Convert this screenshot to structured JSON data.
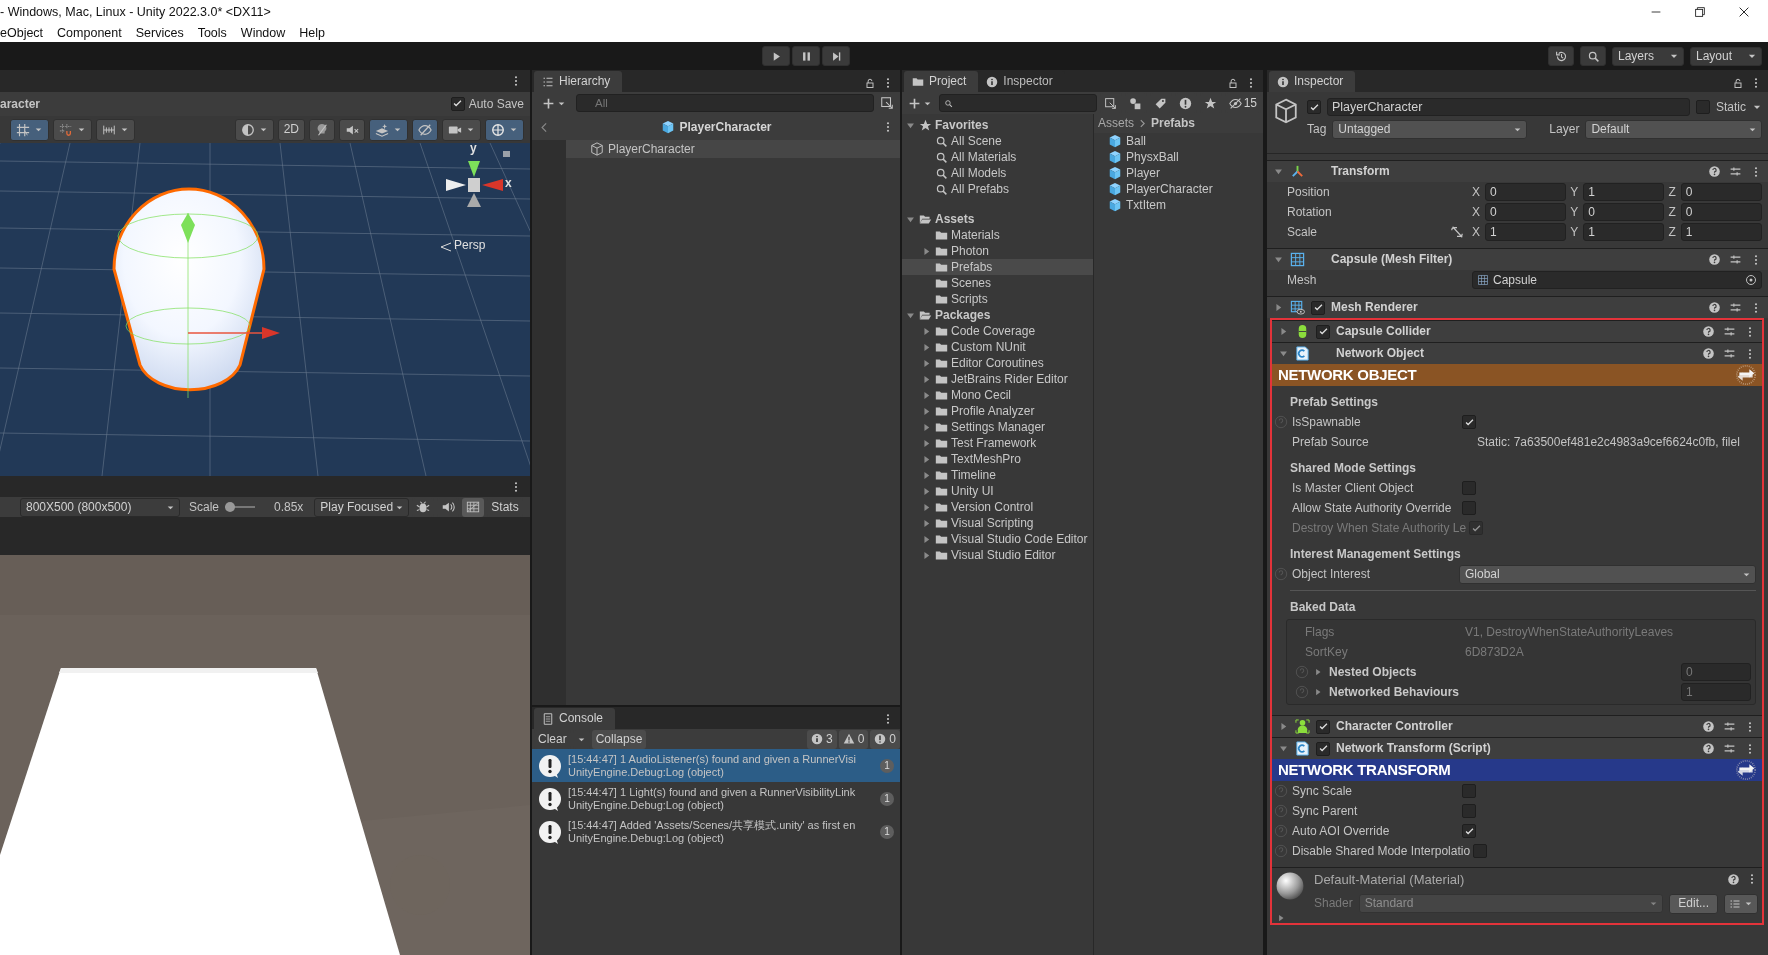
{
  "window": {
    "title": "- Windows, Mac, Linux - Unity 2022.3.0* <DX11>"
  },
  "menu": [
    "eObject",
    "Component",
    "Services",
    "Tools",
    "Window",
    "Help"
  ],
  "main_toolbar": {
    "layers": "Layers",
    "layout": "Layout"
  },
  "scene": {
    "title": "aracter",
    "auto_save": {
      "label": "Auto Save",
      "checked": true
    },
    "tools": [
      {
        "kind": "grid",
        "selected": true,
        "dropdown": true
      },
      {
        "kind": "snap",
        "selected": false,
        "dropdown": true
      },
      {
        "kind": "increment",
        "selected": false,
        "dropdown": true
      },
      {
        "kind": "shading",
        "selected": false,
        "dropdown": true
      },
      {
        "kind": "mode2d",
        "label": "2D",
        "selected": false,
        "dropdown": false
      },
      {
        "kind": "light",
        "selected": false,
        "dropdown": false
      },
      {
        "kind": "audio",
        "selected": false,
        "dropdown": false
      },
      {
        "kind": "effects",
        "selected": true,
        "dropdown": true
      },
      {
        "kind": "visibility",
        "selected": true,
        "dropdown": false
      },
      {
        "kind": "camera",
        "selected": false,
        "dropdown": true
      },
      {
        "kind": "gizmos",
        "selected": true,
        "dropdown": true
      }
    ],
    "gizmo_labels": [
      "y",
      "x"
    ],
    "view": "Persp"
  },
  "game": {
    "resolution": "800X500 (800x500)",
    "scale_label": "Scale",
    "scale": "0.85x",
    "play_mode": "Play Focused",
    "tools": [
      {
        "kind": "bug",
        "selected": false
      },
      {
        "kind": "audio",
        "selected": false
      },
      {
        "kind": "gizmos",
        "selected": true
      }
    ],
    "stats": "Stats"
  },
  "hierarchy": {
    "tab": "Hierarchy",
    "search_placeholder": "All",
    "header": "PlayerCharacter",
    "items": [
      {
        "label": "PlayerCharacter",
        "selected": true
      }
    ]
  },
  "console": {
    "tab": "Console",
    "clear": "Clear",
    "collapse": "Collapse",
    "counts": [
      {
        "kind": "info",
        "value": "3"
      },
      {
        "kind": "warning",
        "value": "0"
      },
      {
        "kind": "error",
        "value": "0"
      }
    ],
    "messages": [
      {
        "line1": "[15:44:47] 1 AudioListener(s) found and given a RunnerVisi",
        "line2": "UnityEngine.Debug:Log (object)",
        "count": "1",
        "selected": true
      },
      {
        "line1": "[15:44:47] 1 Light(s) found and given a RunnerVisibilityLink",
        "line2": "UnityEngine.Debug:Log (object)",
        "count": "1",
        "selected": false
      },
      {
        "line1": "[15:44:47] Added 'Assets/Scenes/共享模式.unity' as first en",
        "line2": "UnityEngine.Debug:Log (object)",
        "count": "1",
        "selected": false
      }
    ]
  },
  "project": {
    "tabs": [
      {
        "label": "Project",
        "selected": true
      },
      {
        "label": "Inspector",
        "selected": false
      }
    ],
    "hidden_count": "15",
    "tree": [
      {
        "label": "Favorites",
        "kind": "favorites",
        "selected": false,
        "children": [
          {
            "label": "All Scene",
            "kind": "search",
            "selected": false
          },
          {
            "label": "All Materials",
            "kind": "search",
            "selected": false
          },
          {
            "label": "All Models",
            "kind": "search",
            "selected": false
          },
          {
            "label": "All Prefabs",
            "kind": "search",
            "selected": false
          }
        ]
      },
      {
        "label": "Assets",
        "kind": "group",
        "selected": false,
        "children": [
          {
            "label": "Materials",
            "kind": "folder",
            "selected": false
          },
          {
            "label": "Photon",
            "kind": "collapsed_folder",
            "selected": false
          },
          {
            "label": "Prefabs",
            "kind": "folder",
            "selected": true
          },
          {
            "label": "Scenes",
            "kind": "folder",
            "selected": false
          },
          {
            "label": "Scripts",
            "kind": "folder",
            "selected": false
          }
        ]
      },
      {
        "label": "Packages",
        "kind": "group",
        "selected": false,
        "children": [
          {
            "label": "Code Coverage",
            "kind": "collapsed_folder",
            "selected": false
          },
          {
            "label": "Custom NUnit",
            "kind": "collapsed_folder",
            "selected": false
          },
          {
            "label": "Editor Coroutines",
            "kind": "collapsed_folder",
            "selected": false
          },
          {
            "label": "JetBrains Rider Editor",
            "kind": "collapsed_folder",
            "selected": false
          },
          {
            "label": "Mono Cecil",
            "kind": "collapsed_folder",
            "selected": false
          },
          {
            "label": "Profile Analyzer",
            "kind": "collapsed_folder",
            "selected": false
          },
          {
            "label": "Settings Manager",
            "kind": "collapsed_folder",
            "selected": false
          },
          {
            "label": "Test Framework",
            "kind": "collapsed_folder",
            "selected": false
          },
          {
            "label": "TextMeshPro",
            "kind": "collapsed_folder",
            "selected": false
          },
          {
            "label": "Timeline",
            "kind": "collapsed_folder",
            "selected": false
          },
          {
            "label": "Unity UI",
            "kind": "collapsed_folder",
            "selected": false
          },
          {
            "label": "Version Control",
            "kind": "collapsed_folder",
            "selected": false
          },
          {
            "label": "Visual Scripting",
            "kind": "collapsed_folder",
            "selected": false
          },
          {
            "label": "Visual Studio Code Editor",
            "kind": "collapsed_folder",
            "selected": false
          },
          {
            "label": "Visual Studio Editor",
            "kind": "collapsed_folder",
            "selected": false
          }
        ]
      }
    ],
    "breadcrumb": [
      "Assets",
      "Prefabs"
    ],
    "assets": [
      "Ball",
      "PhysxBall",
      "Player",
      "PlayerCharacter",
      "TxtItem"
    ]
  },
  "inspector": {
    "tab": "Inspector",
    "object": {
      "name": "PlayerCharacter",
      "active": true,
      "static_label": "Static",
      "static": false,
      "tag_label": "Tag",
      "tag": "Untagged",
      "layer_label": "Layer",
      "layer": "Default"
    },
    "components": [
      {
        "title": "Transform",
        "kind": "transform",
        "expanded": true,
        "annotated": false,
        "fields": [
          {
            "kind": "vector",
            "label": "Position",
            "constraint_toggle": false,
            "values": [
              {
                "axis": "X",
                "value": "0"
              },
              {
                "axis": "Y",
                "value": "1"
              },
              {
                "axis": "Z",
                "value": "0"
              }
            ]
          },
          {
            "kind": "vector",
            "label": "Rotation",
            "constraint_toggle": false,
            "values": [
              {
                "axis": "X",
                "value": "0"
              },
              {
                "axis": "Y",
                "value": "0"
              },
              {
                "axis": "Z",
                "value": "0"
              }
            ]
          },
          {
            "kind": "vector",
            "label": "Scale",
            "constraint_toggle": true,
            "values": [
              {
                "axis": "X",
                "value": "1"
              },
              {
                "axis": "Y",
                "value": "1"
              },
              {
                "axis": "Z",
                "value": "1"
              }
            ]
          }
        ]
      },
      {
        "title": "Capsule (Mesh Filter)",
        "kind": "mesh_filter",
        "expanded": true,
        "annotated": false,
        "fields": [
          {
            "kind": "object",
            "label": "Mesh",
            "value": "Capsule"
          }
        ]
      },
      {
        "title": "Mesh Renderer",
        "kind": "mesh_renderer",
        "expanded": false,
        "enabled": true,
        "annotated": false
      },
      {
        "title": "Capsule Collider",
        "kind": "collider",
        "expanded": false,
        "enabled": true,
        "annotated": true
      },
      {
        "title": "Network Object",
        "kind": "script",
        "expanded": true,
        "annotated": true,
        "fields": [
          {
            "kind": "banner",
            "text": "NETWORK OBJECT",
            "color": "#8a5424"
          },
          {
            "kind": "section",
            "label": "Prefab Settings"
          },
          {
            "kind": "check",
            "label": "IsSpawnable",
            "checked": true,
            "disabled": false,
            "help": true
          },
          {
            "kind": "text",
            "label": "Prefab Source",
            "value": "Static: 7a63500ef481e2c4983a9cef6624c0fb, filel",
            "disabled": false
          },
          {
            "kind": "section",
            "label": "Shared Mode Settings"
          },
          {
            "kind": "check",
            "label": "Is Master Client Object",
            "checked": false,
            "disabled": false,
            "help": false
          },
          {
            "kind": "check",
            "label": "Allow State Authority Override",
            "checked": false,
            "disabled": false,
            "help": false
          },
          {
            "kind": "check",
            "label": "Destroy When State Authority Le",
            "checked": true,
            "disabled": true,
            "help": false
          },
          {
            "kind": "section",
            "label": "Interest Management Settings"
          },
          {
            "kind": "dropdown",
            "label": "Object Interest",
            "value": "Global",
            "help": true
          },
          {
            "kind": "divider"
          },
          {
            "kind": "section",
            "label": "Baked Data"
          },
          {
            "kind": "baked",
            "rows": [
              {
                "kind": "text",
                "label": "Flags",
                "value": "V1, DestroyWhenStateAuthorityLeaves",
                "disabled": true
              },
              {
                "kind": "text",
                "label": "SortKey",
                "value": "6D873D2A",
                "disabled": true
              },
              {
                "kind": "count",
                "label": "Nested Objects",
                "value": "0"
              },
              {
                "kind": "count",
                "label": "Networked Behaviours",
                "value": "1"
              }
            ]
          }
        ]
      },
      {
        "title": "Character Controller",
        "kind": "character_controller",
        "expanded": false,
        "enabled": true,
        "annotated": true
      },
      {
        "title": "Network Transform (Script)",
        "kind": "script",
        "expanded": true,
        "enabled": true,
        "annotated": true,
        "fields": [
          {
            "kind": "banner",
            "text": "NETWORK TRANSFORM",
            "color": "#26398a"
          },
          {
            "kind": "check",
            "label": "Sync Scale",
            "checked": false,
            "disabled": false,
            "help": true
          },
          {
            "kind": "check",
            "label": "Sync Parent",
            "checked": false,
            "disabled": false,
            "help": true
          },
          {
            "kind": "check",
            "label": "Auto AOI Override",
            "checked": true,
            "disabled": false,
            "help": true
          },
          {
            "kind": "check",
            "label": "Disable Shared Mode Interpolatio",
            "checked": false,
            "disabled": false,
            "help": true
          }
        ]
      },
      {
        "title": "Default-Material (Material)",
        "kind": "material",
        "expanded": false,
        "annotated": true,
        "shader_label": "Shader",
        "shader": "Standard",
        "edit": "Edit..."
      }
    ]
  }
}
